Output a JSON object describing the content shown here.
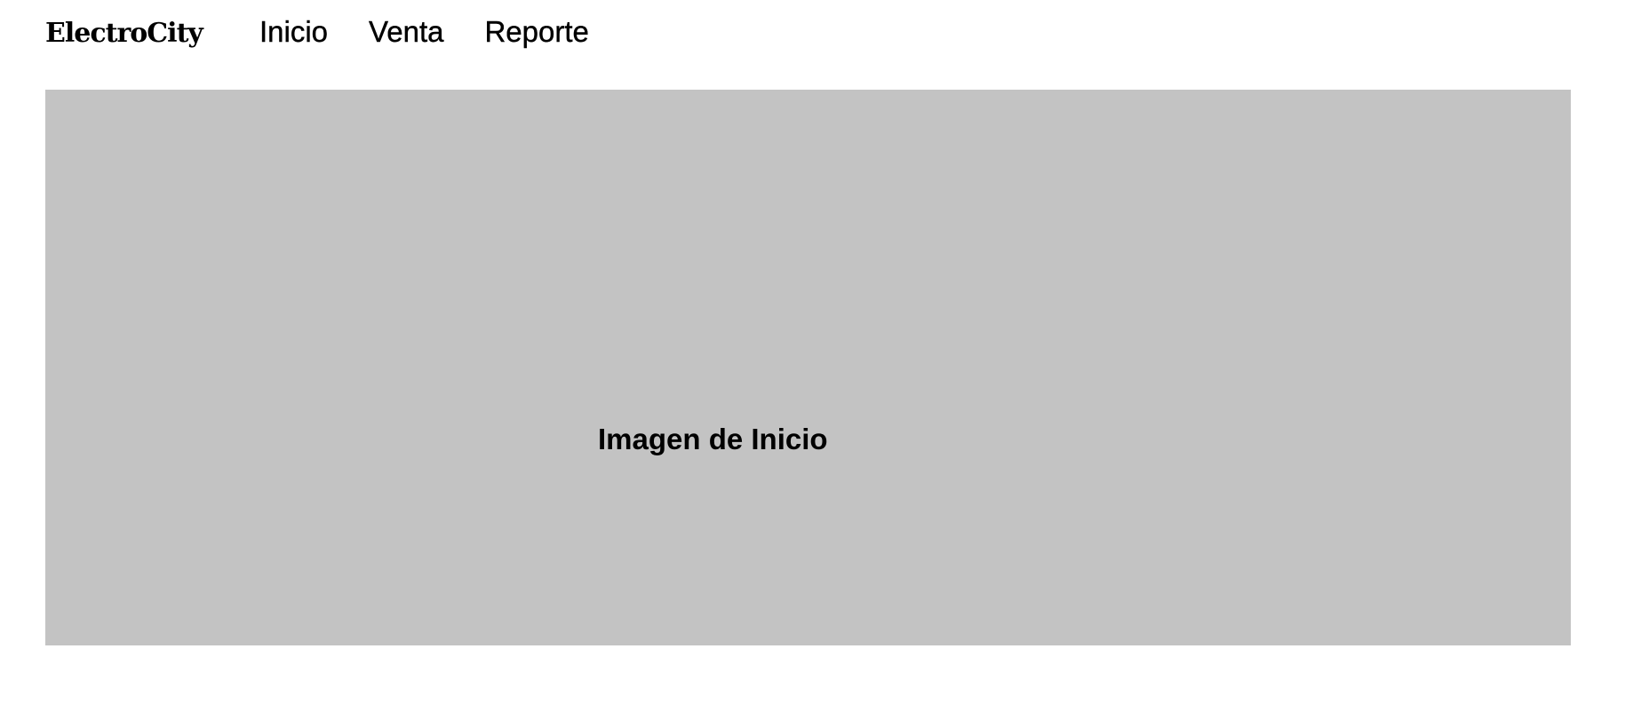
{
  "header": {
    "brand": "ElectroCity",
    "nav": [
      {
        "label": "Inicio"
      },
      {
        "label": "Venta"
      },
      {
        "label": "Reporte"
      }
    ]
  },
  "hero": {
    "caption": "Imagen de Inicio",
    "background_color": "#c3c3c3"
  },
  "colors": {
    "page_background": "#ffffff",
    "text": "#000000"
  }
}
